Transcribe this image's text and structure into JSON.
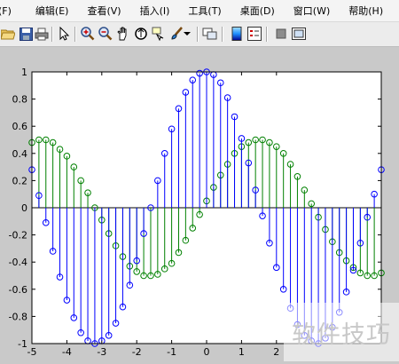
{
  "menubar": {
    "items": [
      {
        "label": "(F)",
        "name": "menu-file"
      },
      {
        "label": "编辑(E)",
        "name": "menu-edit"
      },
      {
        "label": "查看(V)",
        "name": "menu-view"
      },
      {
        "label": "插入(I)",
        "name": "menu-insert"
      },
      {
        "label": "工具(T)",
        "name": "menu-tools"
      },
      {
        "label": "桌面(D)",
        "name": "menu-desktop"
      },
      {
        "label": "窗口(W)",
        "name": "menu-window"
      },
      {
        "label": "帮助(H)",
        "name": "menu-help"
      }
    ]
  },
  "toolbar": {
    "icons": [
      "open-folder-icon",
      "save-icon",
      "print-icon",
      "arrow-pointer-icon",
      "zoom-in-icon",
      "zoom-out-icon",
      "pan-hand-icon",
      "rotate-3d-icon",
      "data-cursor-icon",
      "brush-icon",
      "dropdown-arrow-icon",
      "link-plot-icon",
      "colorbar-icon",
      "legend-icon",
      "hide-plot-tools-icon",
      "show-plot-tools-icon"
    ]
  },
  "colors": {
    "blue_series": "#0000ff",
    "green_series": "#008000"
  },
  "watermark": {
    "text": "软件技巧"
  },
  "chart_data": {
    "type": "stem",
    "title": "",
    "xlabel": "",
    "ylabel": "",
    "xlim": [
      -5,
      5
    ],
    "ylim": [
      -1,
      1
    ],
    "x_ticks": [
      -5,
      -4,
      -3,
      -2,
      -1,
      0,
      1,
      2
    ],
    "y_ticks": [
      1,
      0.8,
      0.6,
      0.4,
      0.2,
      0,
      -0.2,
      -0.4,
      -0.6,
      -0.8,
      -1
    ],
    "x_tick_labels": [
      "-5",
      "-4",
      "-3",
      "-2",
      "-1",
      "0",
      "1",
      "2"
    ],
    "y_tick_labels": [
      "1",
      "0.8",
      "0.6",
      "0.4",
      "0.2",
      "0",
      "-0.2",
      "-0.4",
      "-0.6",
      "-0.8",
      "-1"
    ],
    "series": [
      {
        "color": "#0000ff",
        "x": [
          -5.0,
          -4.8,
          -4.6,
          -4.4,
          -4.2,
          -4.0,
          -3.8,
          -3.6,
          -3.4,
          -3.2,
          -3.0,
          -2.8,
          -2.6,
          -2.4,
          -2.2,
          -2.0,
          -1.8,
          -1.6,
          -1.4,
          -1.2,
          -1.0,
          -0.8,
          -0.6,
          -0.4,
          -0.2,
          0.0,
          0.2,
          0.4,
          0.6,
          0.8,
          1.0,
          1.2,
          1.4,
          1.6,
          1.8,
          2.0,
          2.2,
          2.4,
          2.6,
          2.8,
          3.0,
          3.2,
          3.4,
          3.6,
          3.8,
          4.0,
          4.2,
          4.4,
          4.6,
          4.8,
          5.0
        ],
        "values": [
          0.28,
          0.09,
          -0.11,
          -0.32,
          -0.51,
          -0.68,
          -0.81,
          -0.92,
          -0.98,
          -1.0,
          -0.98,
          -0.94,
          -0.85,
          -0.73,
          -0.57,
          -0.39,
          -0.19,
          0.0,
          0.2,
          0.4,
          0.58,
          0.73,
          0.85,
          0.94,
          0.99,
          1.0,
          0.98,
          0.92,
          0.81,
          0.67,
          0.51,
          0.33,
          0.13,
          -0.06,
          -0.26,
          -0.44,
          -0.6,
          -0.74,
          -0.86,
          -0.94,
          -0.98,
          -1.0,
          -0.96,
          -0.88,
          -0.77,
          -0.62,
          -0.46,
          -0.26,
          -0.07,
          0.1,
          0.28
        ]
      },
      {
        "color": "#008000",
        "x": [
          -5.0,
          -4.8,
          -4.6,
          -4.4,
          -4.2,
          -4.0,
          -3.8,
          -3.6,
          -3.4,
          -3.2,
          -3.0,
          -2.8,
          -2.6,
          -2.4,
          -2.2,
          -2.0,
          -1.8,
          -1.6,
          -1.4,
          -1.2,
          -1.0,
          -0.8,
          -0.6,
          -0.4,
          -0.2,
          0.0,
          0.2,
          0.4,
          0.6,
          0.8,
          1.0,
          1.2,
          1.4,
          1.6,
          1.8,
          2.0,
          2.2,
          2.4,
          2.6,
          2.8,
          3.0,
          3.2,
          3.4,
          3.6,
          3.8,
          4.0,
          4.2,
          4.4,
          4.6,
          4.8,
          5.0
        ],
        "values": [
          0.48,
          0.5,
          0.5,
          0.48,
          0.43,
          0.38,
          0.3,
          0.2,
          0.11,
          0.0,
          -0.09,
          -0.19,
          -0.28,
          -0.36,
          -0.43,
          -0.47,
          -0.5,
          -0.5,
          -0.49,
          -0.45,
          -0.41,
          -0.33,
          -0.24,
          -0.15,
          -0.05,
          0.05,
          0.15,
          0.24,
          0.32,
          0.4,
          0.45,
          0.48,
          0.5,
          0.5,
          0.48,
          0.45,
          0.4,
          0.32,
          0.23,
          0.13,
          0.03,
          -0.07,
          -0.16,
          -0.25,
          -0.33,
          -0.39,
          -0.44,
          -0.48,
          -0.5,
          -0.5,
          -0.48
        ]
      }
    ]
  }
}
